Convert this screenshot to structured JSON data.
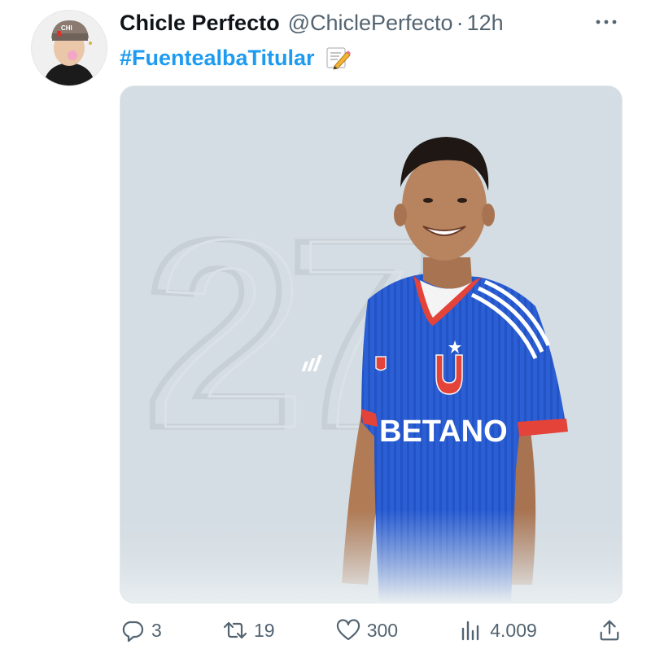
{
  "author": {
    "name": "Chicle Perfecto",
    "handle": "@ChiclePerfecto",
    "separator": "·",
    "time": "12h"
  },
  "tweet": {
    "hashtag": "#FuentealbaTitular",
    "emoji": "memo-pencil-icon"
  },
  "media": {
    "jersey_number": "27",
    "sponsor": "BETANO",
    "background_color": "#d4dde3",
    "jersey_color": "#2a5fd6"
  },
  "actions": {
    "replies": "3",
    "retweets": "19",
    "likes": "300",
    "views": "4.009"
  },
  "icons": {
    "reply": "reply-icon",
    "retweet": "retweet-icon",
    "like": "heart-icon",
    "views": "views-icon",
    "share": "share-icon",
    "more": "more-icon"
  },
  "colors": {
    "link": "#1d9bf0",
    "muted": "#536471",
    "text": "#0f1419"
  }
}
